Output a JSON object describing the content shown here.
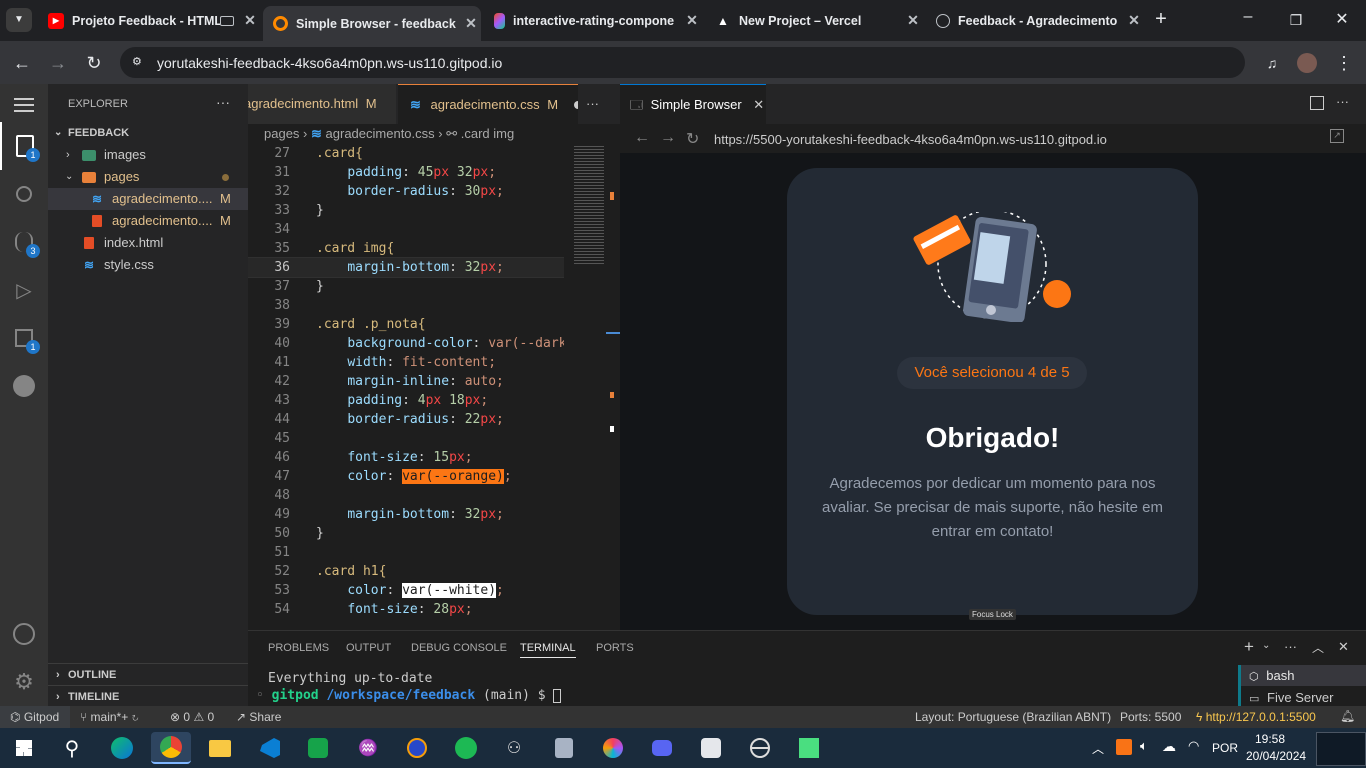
{
  "browser": {
    "tabs": [
      {
        "label": "Projeto Feedback - HTML",
        "icon": "youtube-icon",
        "color": "#ff0000"
      },
      {
        "label": "Simple Browser - feedback",
        "icon": "gitpod-icon",
        "color": "#ff8a00"
      },
      {
        "label": "interactive-rating-compone",
        "icon": "figma-icon",
        "color": "#f24e1e"
      },
      {
        "label": "New Project – Vercel",
        "icon": "vercel-icon",
        "color": "#ffffff"
      },
      {
        "label": "Feedback - Agradecimento",
        "icon": "globe-icon",
        "color": "#9aa0a6"
      }
    ],
    "url": "yorutakeshi-feedback-4kso6a4m0pn.ws-us110.gitpod.io"
  },
  "activity_bar": {
    "explorer_badge": "1",
    "scm_badge": "3",
    "extensions_badge": "1"
  },
  "explorer": {
    "title": "EXPLORER",
    "root": "FEEDBACK",
    "items": [
      {
        "label": "images",
        "type": "folder"
      },
      {
        "label": "pages",
        "type": "folder"
      },
      {
        "label": "agradecimento....",
        "type": "css",
        "status": "M"
      },
      {
        "label": "agradecimento....",
        "type": "html",
        "status": "M"
      },
      {
        "label": "index.html",
        "type": "html"
      },
      {
        "label": "style.css",
        "type": "css"
      }
    ],
    "outline": "OUTLINE",
    "timeline": "TIMELINE"
  },
  "editor": {
    "tabs": [
      {
        "label": "agradecimento.html",
        "status": "M"
      },
      {
        "label": "agradecimento.css",
        "status": "M"
      }
    ],
    "breadcrumb": [
      "pages",
      "agradecimento.css",
      ".card img"
    ],
    "lines": [
      {
        "n": "27",
        "t": ".card{"
      },
      {
        "n": "31",
        "t": "    padding: 45px 32px;"
      },
      {
        "n": "32",
        "t": "    border-radius: 30px;"
      },
      {
        "n": "33",
        "t": "}"
      },
      {
        "n": "34",
        "t": ""
      },
      {
        "n": "35",
        "t": ".card img{"
      },
      {
        "n": "36",
        "t": "    margin-bottom: 32px;"
      },
      {
        "n": "37",
        "t": "}"
      },
      {
        "n": "38",
        "t": ""
      },
      {
        "n": "39",
        "t": ".card .p_nota{"
      },
      {
        "n": "40",
        "t": "    background-color: var(--dark-"
      },
      {
        "n": "41",
        "t": "    width: fit-content;"
      },
      {
        "n": "42",
        "t": "    margin-inline: auto;"
      },
      {
        "n": "43",
        "t": "    padding: 4px 18px;"
      },
      {
        "n": "44",
        "t": "    border-radius: 22px;"
      },
      {
        "n": "45",
        "t": ""
      },
      {
        "n": "46",
        "t": "    font-size: 15px;"
      },
      {
        "n": "47",
        "t": "    color: var(--orange);"
      },
      {
        "n": "48",
        "t": ""
      },
      {
        "n": "49",
        "t": "    margin-bottom: 32px;"
      },
      {
        "n": "50",
        "t": "}"
      },
      {
        "n": "51",
        "t": ""
      },
      {
        "n": "52",
        "t": ".card h1{"
      },
      {
        "n": "53",
        "t": "    color: var(--white);"
      },
      {
        "n": "54",
        "t": "    font-size: 28px;"
      }
    ]
  },
  "simple_browser": {
    "tab_label": "Simple Browser",
    "url": "https://5500-yorutakeshi-feedback-4kso6a4m0pn.ws-us110.gitpod.io",
    "focus_lock": "Focus Lock",
    "card": {
      "pill": "Você selecionou 4 de 5",
      "title": "Obrigado!",
      "text": "Agradecemos por dedicar um momento para nos avaliar. Se precisar de mais suporte, não hesite em entrar em contato!"
    }
  },
  "panel": {
    "tabs": [
      "PROBLEMS",
      "OUTPUT",
      "DEBUG CONSOLE",
      "TERMINAL",
      "PORTS"
    ],
    "terminal_line1": "Everything up-to-date",
    "prompt_user": "gitpod",
    "prompt_path": "/workspace/feedback",
    "prompt_branch": "(main) $",
    "terminals": [
      "bash",
      "Five Server"
    ]
  },
  "statusbar": {
    "remote": "Gitpod",
    "branch": "main*+",
    "problems": "0",
    "warnings": "0",
    "share": "Share",
    "layout": "Layout: Portuguese (Brazilian ABNT)",
    "ports": "Ports: 5500",
    "server": "http://127.0.0.1:5500"
  },
  "taskbar": {
    "lang": "POR",
    "time": "19:58",
    "date": "20/04/2024"
  }
}
